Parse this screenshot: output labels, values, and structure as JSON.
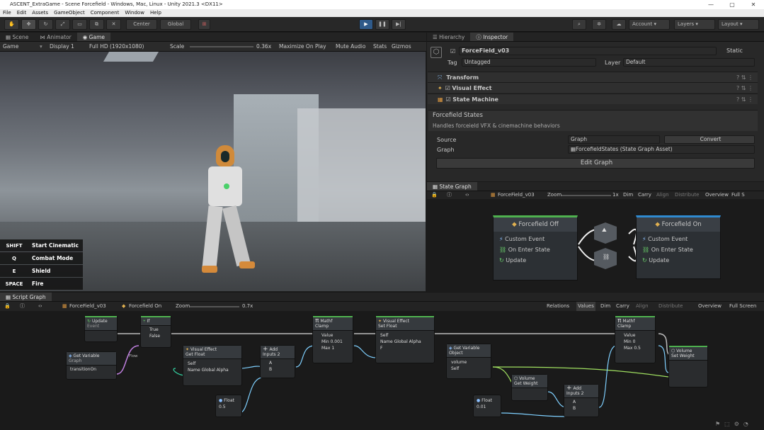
{
  "window": {
    "title": "ASCENT_ExtraGame - Scene Forcefield - Windows, Mac, Linux - Unity 2021.3 <DX11>",
    "controls": [
      "—",
      "▢",
      "✕"
    ]
  },
  "menu": [
    "File",
    "Edit",
    "Assets",
    "GameObject",
    "Component",
    "Window",
    "Help"
  ],
  "toolbar": {
    "pivot": "Center",
    "space": "Global",
    "account": "Account",
    "layers": "Layers",
    "layout": "Layout"
  },
  "scene_tabs": [
    "Scene",
    "Animator",
    "Game"
  ],
  "game_bar": {
    "display_mode": "Game",
    "display": "Display 1",
    "resolution": "Full HD (1920x1080)",
    "scale_label": "Scale",
    "scale_value": "0.36x",
    "maximize": "Maximize On Play",
    "mute": "Mute Audio",
    "stats": "Stats",
    "gizmos": "Gizmos"
  },
  "hotkeys": [
    {
      "key": "SHIFT",
      "label": "Start Cinematic"
    },
    {
      "key": "Q",
      "label": "Combat Mode"
    },
    {
      "key": "E",
      "label": "Shield"
    },
    {
      "key": "SPACE",
      "label": "Fire"
    }
  ],
  "right_tabs": [
    "Hierarchy",
    "Inspector"
  ],
  "inspector": {
    "object_name": "ForceField_v03",
    "static": "Static",
    "tag_label": "Tag",
    "tag_value": "Untagged",
    "layer_label": "Layer",
    "layer_value": "Default",
    "components": [
      "Transform",
      "Visual Effect",
      "State Machine"
    ],
    "state_title": "Forcefield States",
    "state_desc": "Handles forceield VFX & cinemachine behaviors",
    "source_label": "Source",
    "source_value": "Graph",
    "convert": "Convert",
    "graph_label": "Graph",
    "graph_value": "ForcefieldStates (State Graph Asset)",
    "edit_graph": "Edit Graph"
  },
  "state_graph": {
    "tab": "State Graph",
    "breadcrumb": "ForceField_v03",
    "zoom_label": "Zoom",
    "zoom_value": "1x",
    "tools": [
      "Dim",
      "Carry",
      "Align",
      "Distribute",
      "Overview",
      "Full S"
    ],
    "nodes": [
      {
        "title": "Forcefield Off",
        "items": [
          "Custom Event",
          "On Enter State",
          "Update"
        ]
      },
      {
        "title": "Forcefield On",
        "items": [
          "Custom Event",
          "On Enter State",
          "Update"
        ]
      }
    ]
  },
  "script_graph": {
    "tab": "Script Graph",
    "breadcrumb1": "ForceField_v03",
    "breadcrumb2": "Forcefield On",
    "zoom_label": "Zoom",
    "zoom_value": "0.7x",
    "tools": [
      "Relations",
      "Values",
      "Dim",
      "Carry",
      "Align",
      "Distribute",
      "Overview",
      "Full Screen"
    ],
    "nodes": {
      "update": [
        "Update",
        "Event"
      ],
      "if": [
        "If",
        "True",
        "False"
      ],
      "get_variable": [
        "Get Variable",
        "Graph",
        "transitionOn"
      ],
      "flow": "Flow",
      "vfx_get": [
        "Visual Effect",
        "Get Float",
        "Self",
        "Name",
        "Global Alpha"
      ],
      "add1": [
        "Add",
        "Inputs",
        "2",
        "A",
        "B"
      ],
      "float1": [
        "Float",
        "0.5"
      ],
      "clamp": [
        "Mathf",
        "Clamp",
        "Value",
        "Min",
        "0.001",
        "Max",
        "1"
      ],
      "vfx_set": [
        "Visual Effect",
        "Set Float",
        "Self",
        "Name",
        "Global Alpha",
        "F"
      ],
      "get_variable2": [
        "Get Variable",
        "Object",
        "volume",
        "Self"
      ],
      "vol_get": [
        "Volume",
        "Get Weight"
      ],
      "add2": [
        "Add",
        "Inputs",
        "2",
        "A",
        "B"
      ],
      "float2": [
        "Float",
        "0.01"
      ],
      "clamp2": [
        "Mathf",
        "Clamp",
        "Value",
        "Min",
        "0",
        "Max",
        "0.5"
      ],
      "vol_set": [
        "Volume",
        "Set Weight"
      ]
    }
  }
}
